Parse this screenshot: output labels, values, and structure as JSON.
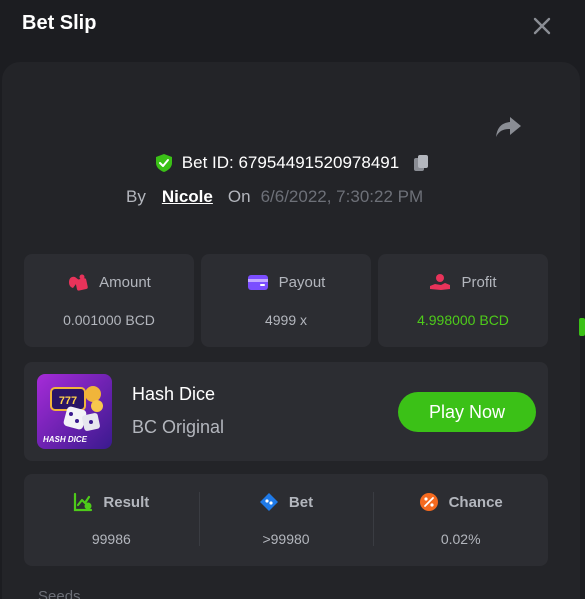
{
  "header": {
    "title": "Bet Slip"
  },
  "bet": {
    "id_label": "Bet ID: 67954491520978491",
    "by_label": "By",
    "user": "Nicole",
    "on_label": "On",
    "datetime": "6/6/2022, 7:30:22 PM"
  },
  "stats": [
    {
      "label": "Amount",
      "value": "0.001000 BCD",
      "icon": "dice-coins-icon"
    },
    {
      "label": "Payout",
      "value": "4999 x",
      "icon": "wallet-icon"
    },
    {
      "label": "Profit",
      "value": "4.998000 BCD",
      "icon": "profit-hand-icon"
    }
  ],
  "game": {
    "name": "Hash Dice",
    "subtitle": "BC Original",
    "thumb_text": "HASH DICE",
    "play_label": "Play Now"
  },
  "results": [
    {
      "label": "Result",
      "value": "99986",
      "icon": "result-chart-icon"
    },
    {
      "label": "Bet",
      "value": ">99980",
      "icon": "bet-ticket-icon"
    },
    {
      "label": "Chance",
      "value": "0.02%",
      "icon": "percent-icon"
    }
  ],
  "footer": {
    "clipped_text": "Seeds"
  },
  "colors": {
    "accent": "#3bc117",
    "profit": "#4ecb1a",
    "panel": "#2c2d32",
    "background": "#1c1d21"
  }
}
